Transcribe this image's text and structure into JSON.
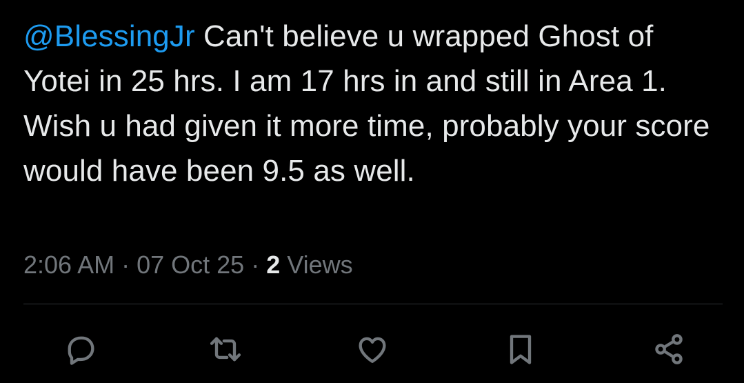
{
  "tweet": {
    "mention": "@BlessingJr",
    "body": " Can't believe u wrapped Ghost of Yotei in 25 hrs. I am 17 hrs in and still in Area 1. Wish u had given it more time, probably your score would have been 9.5 as well."
  },
  "meta": {
    "time": "2:06 AM",
    "separator": " · ",
    "date": "07 Oct 25",
    "views_count": "2",
    "views_label": " Views"
  },
  "actions": {
    "reply_icon": "speech-bubble-icon",
    "repost_icon": "repost-arrows-icon",
    "like_icon": "heart-icon",
    "bookmark_icon": "bookmark-icon",
    "share_icon": "share-nodes-icon"
  },
  "colors": {
    "background": "#000000",
    "text": "#e7e9ea",
    "mention": "#1d9bf0",
    "muted": "#71767b",
    "divider": "#2f3336"
  }
}
